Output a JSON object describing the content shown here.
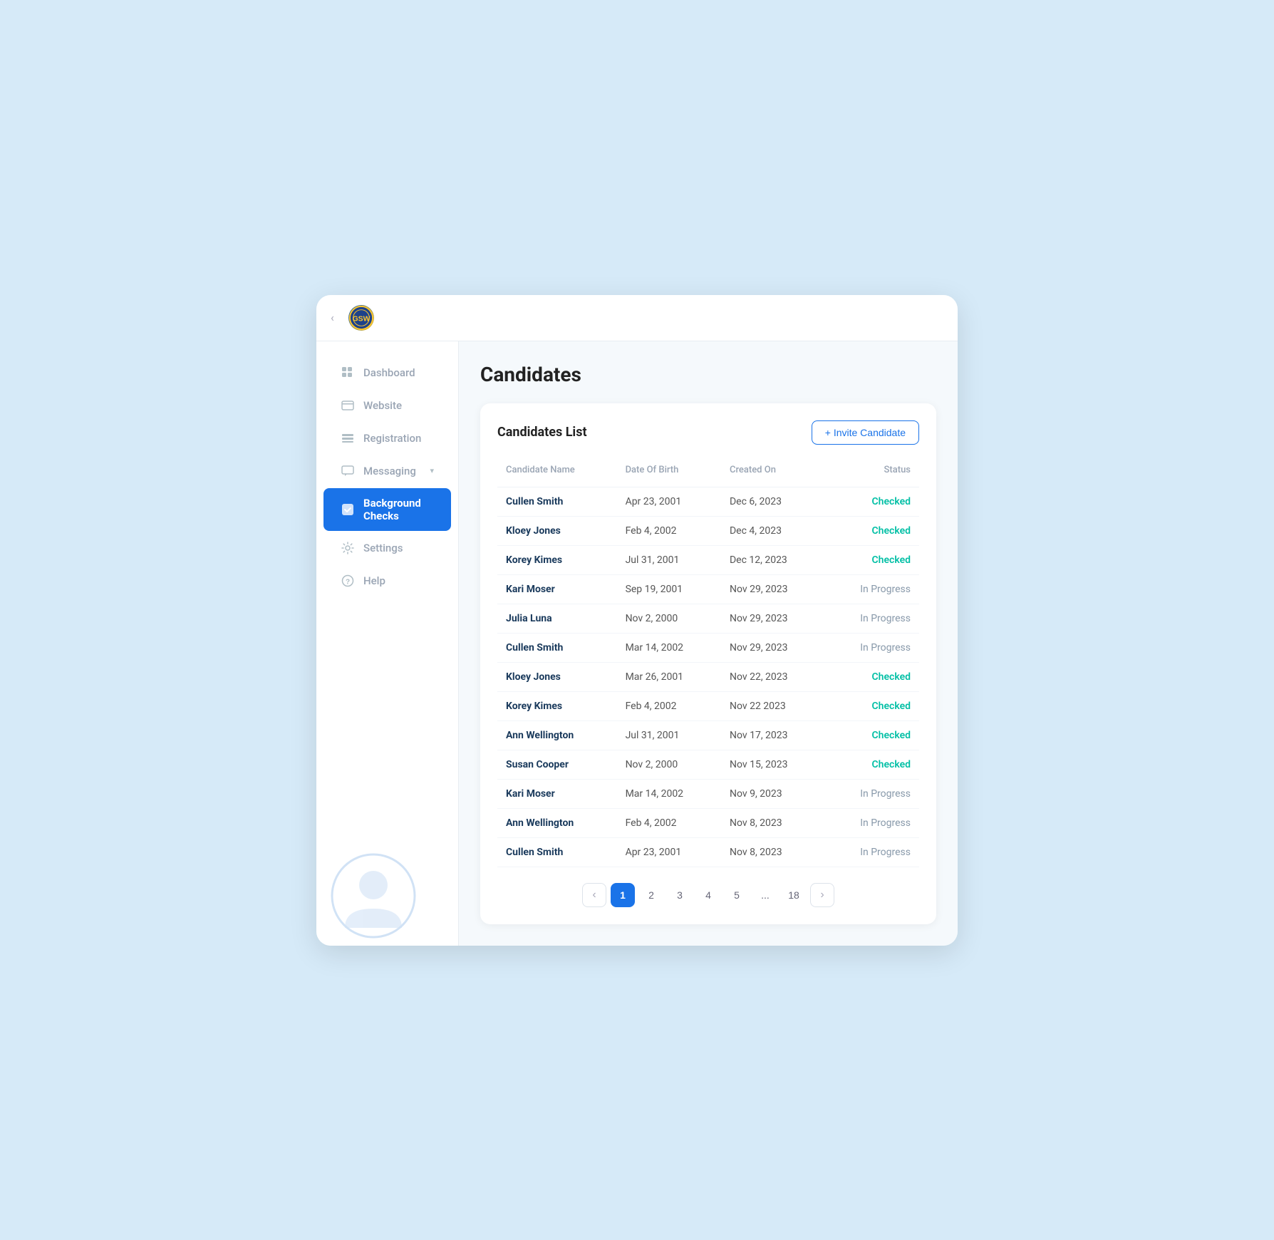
{
  "topbar": {
    "chevron": "‹",
    "logo_alt": "Golden State Warriors Logo"
  },
  "sidebar": {
    "items": [
      {
        "id": "dashboard",
        "label": "Dashboard",
        "icon": "grid",
        "active": false
      },
      {
        "id": "website",
        "label": "Website",
        "icon": "website",
        "active": false
      },
      {
        "id": "registration",
        "label": "Registration",
        "icon": "registration",
        "active": false
      },
      {
        "id": "messaging",
        "label": "Messaging",
        "icon": "messaging",
        "active": false,
        "has_dropdown": true
      },
      {
        "id": "background-checks",
        "label": "Background Checks",
        "icon": "check",
        "active": true
      },
      {
        "id": "settings",
        "label": "Settings",
        "icon": "settings",
        "active": false
      },
      {
        "id": "help",
        "label": "Help",
        "icon": "help",
        "active": false
      }
    ]
  },
  "page": {
    "title": "Candidates"
  },
  "card": {
    "title": "Candidates List",
    "invite_button": "+ Invite Candidate"
  },
  "table": {
    "headers": [
      "Candidate Name",
      "Date Of Birth",
      "Created On",
      "Status"
    ],
    "rows": [
      {
        "name": "Cullen Smith",
        "dob": "Apr 23, 2001",
        "created": "Dec 6, 2023",
        "status": "Checked",
        "status_type": "checked"
      },
      {
        "name": "Kloey Jones",
        "dob": "Feb 4, 2002",
        "created": "Dec 4, 2023",
        "status": "Checked",
        "status_type": "checked"
      },
      {
        "name": "Korey Kimes",
        "dob": "Jul 31, 2001",
        "created": "Dec 12, 2023",
        "status": "Checked",
        "status_type": "checked"
      },
      {
        "name": "Kari Moser",
        "dob": "Sep 19, 2001",
        "created": "Nov 29, 2023",
        "status": "In Progress",
        "status_type": "progress"
      },
      {
        "name": "Julia Luna",
        "dob": "Nov 2, 2000",
        "created": "Nov 29, 2023",
        "status": "In Progress",
        "status_type": "progress"
      },
      {
        "name": "Cullen Smith",
        "dob": "Mar 14, 2002",
        "created": "Nov 29, 2023",
        "status": "In Progress",
        "status_type": "progress"
      },
      {
        "name": "Kloey Jones",
        "dob": "Mar 26, 2001",
        "created": "Nov 22, 2023",
        "status": "Checked",
        "status_type": "checked"
      },
      {
        "name": "Korey Kimes",
        "dob": "Feb 4, 2002",
        "created": "Nov 22 2023",
        "status": "Checked",
        "status_type": "checked"
      },
      {
        "name": "Ann Wellington",
        "dob": "Jul 31, 2001",
        "created": "Nov 17, 2023",
        "status": "Checked",
        "status_type": "checked"
      },
      {
        "name": "Susan Cooper",
        "dob": "Nov 2, 2000",
        "created": "Nov 15, 2023",
        "status": "Checked",
        "status_type": "checked"
      },
      {
        "name": "Kari Moser",
        "dob": "Mar 14, 2002",
        "created": "Nov 9, 2023",
        "status": "In Progress",
        "status_type": "progress"
      },
      {
        "name": "Ann Wellington",
        "dob": "Feb 4, 2002",
        "created": "Nov 8, 2023",
        "status": "In Progress",
        "status_type": "progress"
      },
      {
        "name": "Cullen Smith",
        "dob": "Apr 23, 2001",
        "created": "Nov 8, 2023",
        "status": "In Progress",
        "status_type": "progress"
      }
    ]
  },
  "pagination": {
    "pages": [
      "1",
      "2",
      "3",
      "4",
      "5",
      "...",
      "18"
    ],
    "current": "1",
    "prev_arrow": "‹",
    "next_arrow": "›"
  }
}
